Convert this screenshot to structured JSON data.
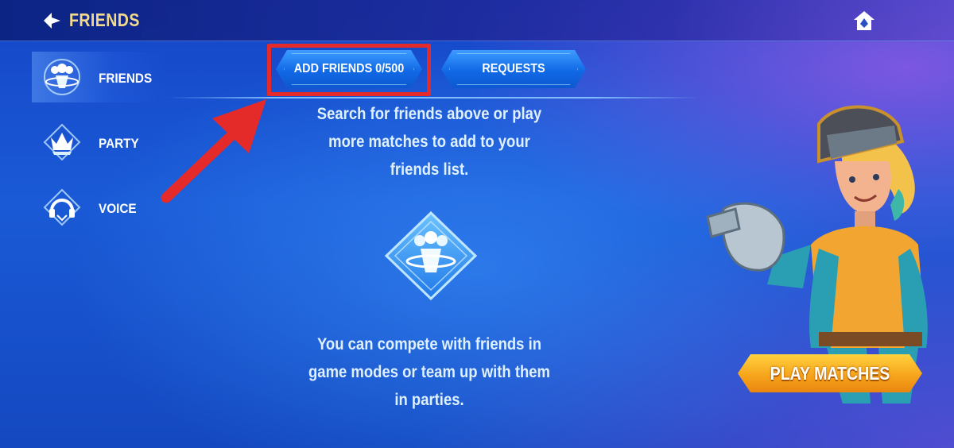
{
  "header": {
    "title": "FRIENDS",
    "back_icon": "back-arrow-icon",
    "home_icon": "home-icon"
  },
  "sidebar": {
    "items": [
      {
        "label": "FRIENDS",
        "icon": "friends-icon",
        "active": true
      },
      {
        "label": "PARTY",
        "icon": "crown-icon",
        "active": false
      },
      {
        "label": "VOICE",
        "icon": "headset-icon",
        "active": false
      }
    ]
  },
  "tabs": {
    "add_friends": "ADD FRIENDS 0/500",
    "requests": "REQUESTS"
  },
  "main": {
    "message_top": "Search for friends above or play more matches to add to your friends list.",
    "message_bottom": "You can compete with friends in game modes or team up with them in parties.",
    "emblem_icon": "friends-emblem-icon"
  },
  "play_button": {
    "label": "PLAY MATCHES"
  },
  "colors": {
    "title_gold": "#f2d98b",
    "annotation_red": "#e52a2a",
    "play_button_orange": "#f7a51c",
    "tab_blue": "#1169e6"
  }
}
